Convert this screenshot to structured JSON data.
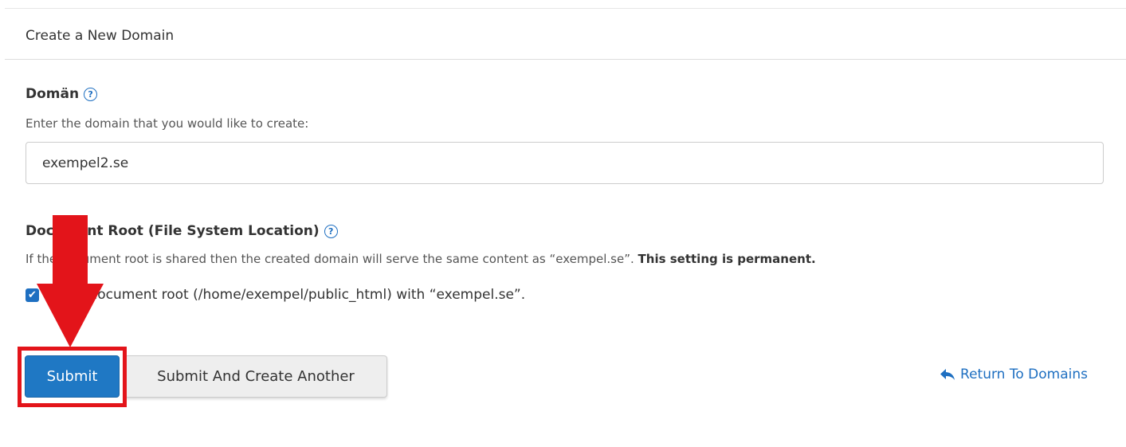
{
  "panel": {
    "title": "Create a New Domain"
  },
  "domain_field": {
    "label": "Domän",
    "help_icon": "question-circle-icon",
    "description": "Enter the domain that you would like to create:",
    "value": "exempel2.se"
  },
  "docroot_field": {
    "label": "Document Root (File System Location)",
    "help_icon": "question-circle-icon",
    "description_main": "If the document root is shared then the created domain will serve the same content as “exempel.se”.",
    "description_strong": "This setting is permanent.",
    "checkbox_checked": true,
    "checkbox_label": "Share document root (/home/exempel/public_html) with “exempel.se”."
  },
  "actions": {
    "submit_label": "Submit",
    "submit_another_label": "Submit And Create Another",
    "return_label": "Return To Domains",
    "return_icon": "reply-arrow-icon"
  },
  "annotation": {
    "arrow_icon": "red-down-arrow-icon",
    "highlight_color": "#e3141a"
  },
  "colors": {
    "primary": "#1f78c4",
    "link": "#1e6fc1"
  }
}
